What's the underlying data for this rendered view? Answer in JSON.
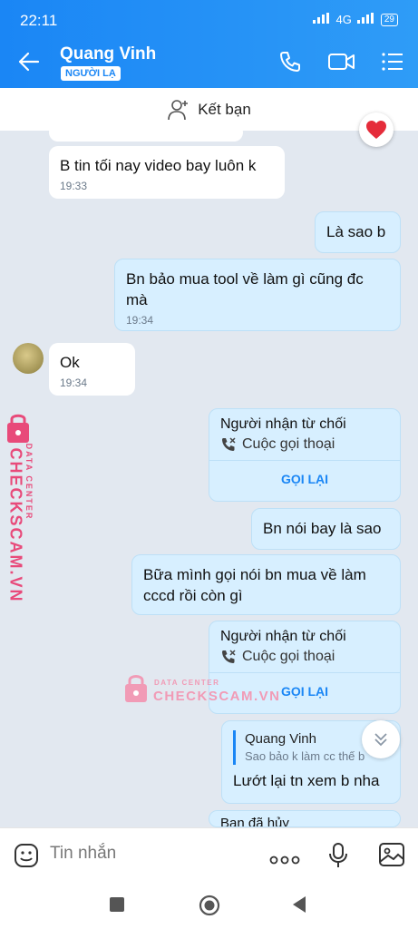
{
  "status": {
    "time": "22:11",
    "network": "4G",
    "battery": "29"
  },
  "header": {
    "contact_name": "Quang Vinh",
    "badge": "NGƯỜI LẠ"
  },
  "friend_bar": {
    "label": "Kết bạn"
  },
  "messages": {
    "m1": {
      "text": "B tin tối nay video bay luôn k",
      "time": "19:33"
    },
    "m2": {
      "text": "Là sao b"
    },
    "m3": {
      "text": "Bn bảo mua tool về làm gì cũng đc mà",
      "time": "19:34"
    },
    "m4": {
      "text": "Ok",
      "time": "19:34"
    },
    "call1": {
      "title": "Người nhận từ chối",
      "type": "Cuộc gọi thoại",
      "action": "GỌI LẠI"
    },
    "m5": {
      "text": "Bn nói bay là sao"
    },
    "m6": {
      "text": "Bữa mình gọi nói bn mua về làm cccd rồi còn gì"
    },
    "call2": {
      "title": "Người nhận từ chối",
      "type": "Cuộc gọi thoại",
      "action": "GỌI LẠI"
    },
    "m7": {
      "quote_name": "Quang Vinh",
      "quote_text": "Sao bảo k làm cc thế b",
      "text": "Lướt lại tn xem b nha"
    },
    "m8": {
      "text": "Bạn đã hủy"
    }
  },
  "watermark": {
    "label": "DATA CENTER",
    "brand": "CHECKSCAM.VN"
  },
  "input": {
    "placeholder": "Tin nhắn"
  },
  "colors": {
    "accent": "#1a86f5",
    "outgoing": "#d7efff",
    "background": "#e2e8f0",
    "watermark": "#e84a7a"
  }
}
